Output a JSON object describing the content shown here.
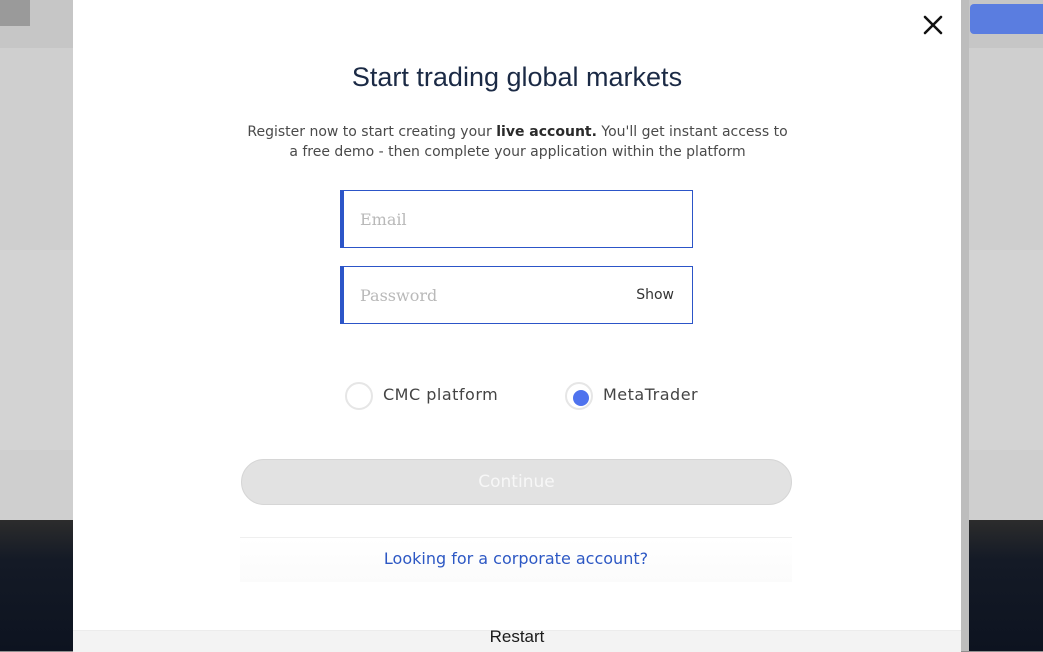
{
  "modal": {
    "title": "Start trading global markets",
    "intro_before": "Register now to start creating your ",
    "intro_bold": "live account.",
    "intro_after": " You'll get instant access to a free demo - then complete your application within the platform",
    "close_icon": "close-icon"
  },
  "form": {
    "email_placeholder": "Email",
    "email_value": "",
    "password_placeholder": "Password",
    "password_value": "",
    "show_label": "Show",
    "platform_options": [
      {
        "label": "CMC platform",
        "selected": false
      },
      {
        "label": "MetaTrader",
        "selected": true
      }
    ],
    "continue_label": "Continue"
  },
  "corporate": {
    "link_text": "Looking for a corporate account?"
  },
  "footer": {
    "restart_label": "Restart"
  },
  "colors": {
    "accent": "#2c55c8",
    "radio_selected": "#4f73ee",
    "link": "#2d58c4",
    "title": "#1b2a45"
  }
}
